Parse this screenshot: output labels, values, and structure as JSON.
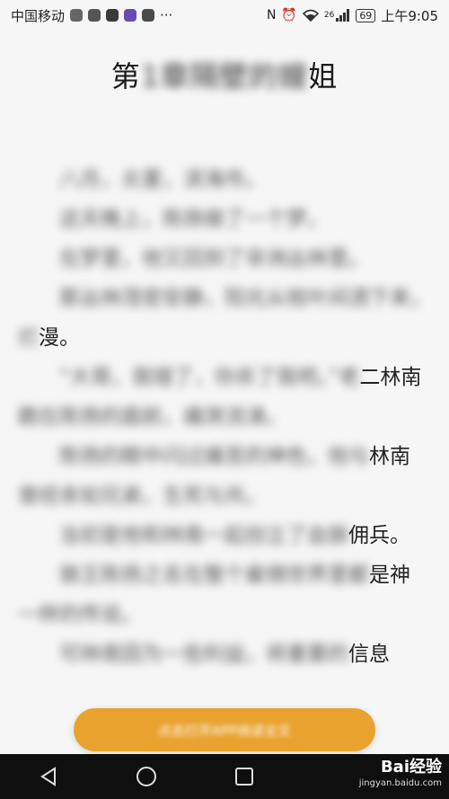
{
  "status_bar": {
    "carrier": "中国移动",
    "more": "···",
    "network": "26",
    "battery": "69",
    "time": "上午9:05"
  },
  "chapter": {
    "title_start": "第",
    "title_blurred": "1章隔壁的嫂",
    "title_end": "姐"
  },
  "paragraphs": [
    {
      "blurred": "八月，炎夏，滨海市。",
      "clear": ""
    },
    {
      "blurred": "这天晚上，陈扬做了一个梦。",
      "clear": ""
    },
    {
      "blurred": "在梦里，他又回到了非洲丛林里。",
      "clear": ""
    },
    {
      "blurred": "那丛林茂密安静，阳光从枝叶间洒下来，烂",
      "clear": "漫。"
    },
    {
      "blurred": "“大哥，我错了，你杀了我吧。”老",
      "clear": "二林南"
    },
    {
      "blurred": "跪在陈扬的面前，痛哭流涕。",
      "clear": ""
    },
    {
      "blurred": "陈扬的眼中闪过痛苦的神色，他与",
      "clear": "林南"
    },
    {
      "blurred": "曾经亲如兄弟，生死与共。",
      "clear": ""
    },
    {
      "blurred": "当初是他和林南一起创立了血狼",
      "clear": "佣兵。"
    },
    {
      "blurred": "狼王陈扬之名在整个雇佣世界里都",
      "clear": "是神"
    },
    {
      "blurred": "一样的传说。",
      "clear": ""
    },
    {
      "blurred": "可林南因为一些利益，将重要的",
      "clear": "信息"
    }
  ],
  "action_button": {
    "label": "点击打开APP阅读全文"
  },
  "watermark": {
    "brand": "Bai经验",
    "url": "jingyan.baidu.com"
  }
}
